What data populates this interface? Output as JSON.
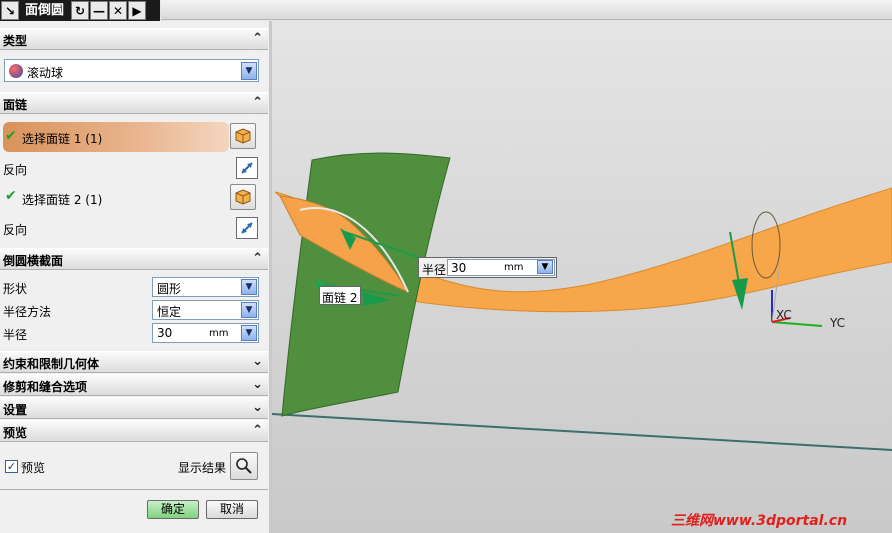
{
  "window": {
    "title": "面倒圆"
  },
  "sections": {
    "type": {
      "title": "类型",
      "value": "滚动球"
    },
    "face_chain": {
      "title": "面链",
      "select1": "选择面链 1 (1)",
      "reverse1": "反向",
      "select2": "选择面链 2 (1)",
      "reverse2": "反向"
    },
    "cross_section": {
      "title": "倒圆横截面",
      "shape_label": "形状",
      "shape_value": "圆形",
      "radius_method_label": "半径方法",
      "radius_method_value": "恒定",
      "radius_label": "半径",
      "radius_value": "30",
      "radius_unit": "mm"
    },
    "constraints": {
      "title": "约束和限制几何体"
    },
    "trim": {
      "title": "修剪和缝合选项"
    },
    "settings": {
      "title": "设置"
    },
    "preview": {
      "title": "预览",
      "checkbox_label": "预览",
      "show_result": "显示结果",
      "checked": true
    }
  },
  "buttons": {
    "ok": "确定",
    "cancel": "取消"
  },
  "viewport": {
    "radius_label": "半径",
    "radius_value": "30",
    "radius_unit": "mm",
    "face_chain_tag": "面链 2",
    "axis_x": "XC",
    "axis_y": "YC"
  },
  "watermark": "三维网www.3dportal.cn",
  "icons": {
    "collapse": "chevron-up-icon",
    "expand": "chevron-down-icon",
    "select_face": "cube-select-icon",
    "reverse": "reverse-direction-icon",
    "show_result": "magnifier-icon"
  },
  "colors": {
    "surface_orange": "#f7a64a",
    "surface_green": "#4a8a3a",
    "selected_row": "#d9925a",
    "ok_green": "#7fd17f"
  }
}
